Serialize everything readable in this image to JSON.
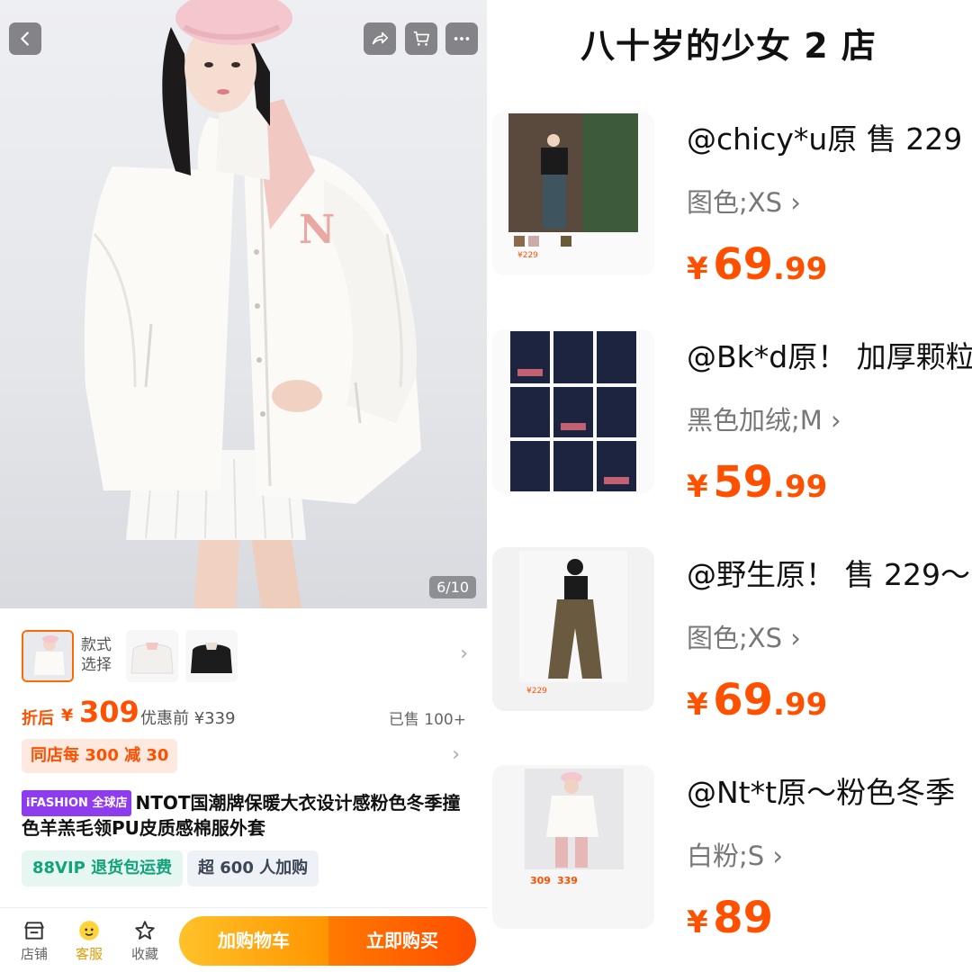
{
  "product": {
    "image_counter": "6/10",
    "variant_label": "款式选择",
    "price_after_label": "折后",
    "currency": "¥",
    "price": "309",
    "price_before": "优惠前 ¥339",
    "sold": "已售 100+",
    "promo": "同店每 300 减 30",
    "badge": "iFASHION 全球店",
    "title": "NTOT国潮牌保暖大衣设计感粉色冬季撞色羊羔毛领PU皮质感棉服外套",
    "tag_vip": "88VIP 退货包运费",
    "tag_buyers": "超 600 人加购"
  },
  "bottom_bar": {
    "shop_label": "店铺",
    "service_label": "客服",
    "favorite_label": "收藏",
    "add_cart_label": "加购物车",
    "buy_now_label": "立即购买"
  },
  "shop": {
    "title": "八十岁的少女 2 店"
  },
  "reviews": [
    {
      "text": "@chicy*u原 售 229",
      "spec": "图色;XS",
      "price_yen": "¥",
      "price_int": "69",
      "price_dec": ".99"
    },
    {
      "text": "@Bk*d原！ 加厚颗粒",
      "spec": "黑色加绒;M",
      "price_yen": "¥",
      "price_int": "59",
      "price_dec": ".99"
    },
    {
      "text": "@野生原！ 售 229～",
      "spec": "图色;XS",
      "price_yen": "¥",
      "price_int": "69",
      "price_dec": ".99"
    },
    {
      "text": "@Nt*t原～粉色冬季",
      "spec": "白粉;S",
      "price_yen": "¥",
      "price_int": "89",
      "price_dec": ""
    }
  ],
  "colors": {
    "accent": "#ff5000",
    "cart_button": "#ffa800",
    "vip_green": "#12a37a",
    "ifashion_purple": "#8f3bf0"
  }
}
